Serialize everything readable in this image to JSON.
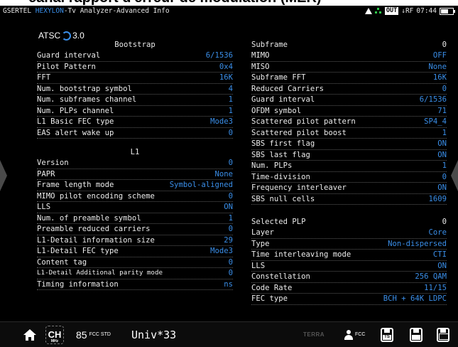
{
  "banner_text": "canal rapport d'erreur de modulation (MER)",
  "statusbar": {
    "prefix": "GSERTEL",
    "brand": "HEXYLON",
    "title": "-Tv Analyzer-Advanced Info",
    "out_badge": "OUT",
    "rf_label": "↓RF",
    "time": "07:44",
    "icons": [
      "warning-icon",
      "network-icon",
      "battery-icon"
    ]
  },
  "logo": {
    "text": "ATSC",
    "version": "3.0"
  },
  "bootstrap": {
    "title": "Bootstrap",
    "rows": [
      {
        "k": "Guard interval",
        "v": "6/1536"
      },
      {
        "k": "Pilot Pattern",
        "v": "0x4"
      },
      {
        "k": "FFT",
        "v": "16K"
      },
      {
        "k": "Num. bootstrap symbol",
        "v": "4"
      },
      {
        "k": "Num. subframes channel",
        "v": "1"
      },
      {
        "k": "Num. PLPs channel",
        "v": "1"
      },
      {
        "k": "L1 Basic FEC type",
        "v": "Mode3"
      },
      {
        "k": "EAS alert wake up",
        "v": "0"
      }
    ]
  },
  "l1": {
    "title": "L1",
    "rows": [
      {
        "k": "Version",
        "v": "0"
      },
      {
        "k": "PAPR",
        "v": "None"
      },
      {
        "k": "Frame length mode",
        "v": "Symbol-aligned"
      },
      {
        "k": "MIMO pilot encoding scheme",
        "v": "0"
      },
      {
        "k": "LLS",
        "v": "ON"
      },
      {
        "k": "Num. of preamble symbol",
        "v": "1"
      },
      {
        "k": "Preamble reduced carriers",
        "v": "0"
      },
      {
        "k": "L1-Detail information size",
        "v": "29"
      },
      {
        "k": "L1-Detail FEC type",
        "v": "Mode3"
      },
      {
        "k": "Content tag",
        "v": "0"
      },
      {
        "k": "L1-Detail Additional parity mode",
        "v": "0"
      },
      {
        "k": "Timing information",
        "v": "ns"
      }
    ]
  },
  "subframe": {
    "title": "Subframe",
    "index": "0",
    "rows": [
      {
        "k": "MIMO",
        "v": "OFF"
      },
      {
        "k": "MISO",
        "v": "None"
      },
      {
        "k": "Subframe FFT",
        "v": "16K"
      },
      {
        "k": "Reduced Carriers",
        "v": "0"
      },
      {
        "k": "Guard interval",
        "v": "6/1536"
      },
      {
        "k": "OFDM symbol",
        "v": "71"
      },
      {
        "k": "Scattered pilot pattern",
        "v": "SP4_4"
      },
      {
        "k": "Scattered pilot boost",
        "v": "1"
      },
      {
        "k": "SBS first flag",
        "v": "ON"
      },
      {
        "k": "SBS last flag",
        "v": "ON"
      },
      {
        "k": "Num. PLPs",
        "v": "1"
      },
      {
        "k": "Time-division",
        "v": "0"
      },
      {
        "k": "Frequency interleaver",
        "v": "ON"
      },
      {
        "k": "SBS null cells",
        "v": "1609"
      }
    ]
  },
  "selected_plp": {
    "title": "Selected PLP",
    "index": "0",
    "rows": [
      {
        "k": "Layer",
        "v": "Core"
      },
      {
        "k": "Type",
        "v": "Non-dispersed"
      },
      {
        "k": "Time interleaving mode",
        "v": "CTI"
      },
      {
        "k": "LLS",
        "v": "ON"
      },
      {
        "k": "Constellation",
        "v": "256 QAM"
      },
      {
        "k": "Code Rate",
        "v": "11/15"
      },
      {
        "k": "FEC type",
        "v": "BCH + 64K LDPC"
      }
    ]
  },
  "bottombar": {
    "ch_label": "CH",
    "ch_sub": "MHz",
    "channel": "85",
    "standard": "FCC STD",
    "program": "Univ*33",
    "terra_label": "TERRA",
    "user_std": "FCC",
    "save_ts_label": "TS",
    "icons": [
      "home-icon",
      "channel-icon",
      "terra-icon",
      "user-icon",
      "save-ts-icon",
      "save-icon",
      "save-all-icon"
    ]
  },
  "colors": {
    "accent": "#3a8ee8",
    "background": "#000000",
    "text": "#e8e8e8"
  }
}
